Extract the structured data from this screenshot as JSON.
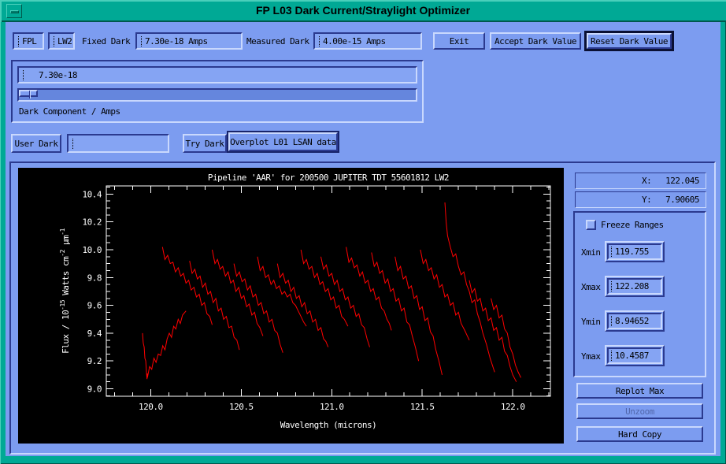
{
  "window": {
    "title": "FP L03 Dark Current/Straylight Optimizer"
  },
  "toolbar": {
    "fpl_value": "FPL",
    "lw2_value": "LW2",
    "fixed_dark_label": "Fixed Dark",
    "fixed_dark_value": "7.30e-18 Amps",
    "measured_dark_label": "Measured Dark",
    "measured_dark_value": "4.00e-15 Amps",
    "exit_label": "Exit",
    "accept_label": "Accept Dark Value",
    "reset_label": "Reset Dark Value"
  },
  "dark_component": {
    "value": "7.30e-18",
    "label": "Dark Component / Amps",
    "slider_fraction": 0.0
  },
  "user_dark": {
    "button_label": "User Dark",
    "input_value": "",
    "try_label": "Try Dark",
    "overplot_label": "Overplot L01 LSAN data"
  },
  "readout": {
    "x_label": "X:",
    "x_value": "122.045",
    "y_label": "Y:",
    "y_value": "7.90605"
  },
  "ranges": {
    "freeze_label": "Freeze Ranges",
    "xmin_label": "Xmin",
    "xmin_value": "119.755",
    "xmax_label": "Xmax",
    "xmax_value": "122.208",
    "ymin_label": "Ymin",
    "ymin_value": "8.94652",
    "ymax_label": "Ymax",
    "ymax_value": "10.4587"
  },
  "actions": {
    "replot_label": "Replot Max",
    "unzoom_label": "Unzoom",
    "hardcopy_label": "Hard Copy"
  },
  "colors": {
    "titlebar": "#00a995",
    "background": "#7c9cf0",
    "plot_bg": "#000000",
    "plot_fg": "#ffffff",
    "series": "#ff0000"
  },
  "chart_data": {
    "type": "line",
    "title": "Pipeline 'AAR' for 200500 JUPITER TDT 55601812 LW2",
    "xlabel": "Wavelength (microns)",
    "ylabel_parts": [
      {
        "t": "Flux  /  10"
      },
      {
        "s": "-15"
      },
      {
        "t": " Watts cm"
      },
      {
        "s": "-2"
      },
      {
        "t": " μm"
      },
      {
        "s": "-1"
      }
    ],
    "xlim": [
      119.755,
      122.208
    ],
    "ylim": [
      8.94652,
      10.4587
    ],
    "x_major_ticks": [
      120.0,
      120.5,
      121.0,
      121.5,
      122.0
    ],
    "x_major_labels": [
      "120.0",
      "120.5",
      "121.0",
      "121.5",
      "122.0"
    ],
    "x_minor_step": 0.1,
    "y_major_ticks": [
      9.0,
      9.2,
      9.4,
      9.6,
      9.8,
      10.0,
      10.2,
      10.4
    ],
    "y_minor_step": 0.05,
    "grid": false,
    "legend": "none",
    "series_color": "#ff0000",
    "scans": [
      [
        [
          119.955,
          9.4
        ],
        [
          119.959,
          9.33
        ],
        [
          119.964,
          9.3
        ],
        [
          119.968,
          9.22
        ],
        [
          119.973,
          9.2
        ],
        [
          119.977,
          9.12
        ],
        [
          119.98,
          9.07
        ],
        [
          119.982,
          9.11
        ]
      ],
      [
        [
          119.982,
          9.08
        ],
        [
          119.994,
          9.16
        ],
        [
          120.006,
          9.14
        ],
        [
          120.018,
          9.22
        ],
        [
          120.03,
          9.19
        ],
        [
          120.042,
          9.25
        ],
        [
          120.055,
          9.24
        ],
        [
          120.067,
          9.31
        ],
        [
          120.079,
          9.28
        ],
        [
          120.091,
          9.36
        ],
        [
          120.103,
          9.4
        ],
        [
          120.115,
          9.37
        ],
        [
          120.127,
          9.45
        ],
        [
          120.139,
          9.43
        ],
        [
          120.152,
          9.5
        ],
        [
          120.164,
          9.47
        ],
        [
          120.176,
          9.53
        ],
        [
          120.195,
          9.56
        ]
      ],
      [
        [
          120.065,
          10.02
        ],
        [
          120.079,
          9.93
        ],
        [
          120.094,
          9.96
        ],
        [
          120.108,
          9.9
        ],
        [
          120.123,
          9.91
        ],
        [
          120.137,
          9.84
        ],
        [
          120.152,
          9.87
        ],
        [
          120.166,
          9.81
        ],
        [
          120.181,
          9.83
        ],
        [
          120.195,
          9.76
        ],
        [
          120.21,
          9.78
        ],
        [
          120.224,
          9.71
        ],
        [
          120.239,
          9.73
        ],
        [
          120.253,
          9.66
        ],
        [
          120.268,
          9.68
        ],
        [
          120.282,
          9.6
        ],
        [
          120.297,
          9.62
        ],
        [
          120.311,
          9.54
        ],
        [
          120.326,
          9.52
        ],
        [
          120.34,
          9.46
        ]
      ],
      [
        [
          120.215,
          9.92
        ],
        [
          120.229,
          9.83
        ],
        [
          120.244,
          9.86
        ],
        [
          120.258,
          9.79
        ],
        [
          120.273,
          9.81
        ],
        [
          120.287,
          9.73
        ],
        [
          120.302,
          9.76
        ],
        [
          120.316,
          9.68
        ],
        [
          120.331,
          9.7
        ],
        [
          120.345,
          9.62
        ],
        [
          120.36,
          9.65
        ],
        [
          120.374,
          9.56
        ],
        [
          120.389,
          9.58
        ],
        [
          120.403,
          9.5
        ],
        [
          120.418,
          9.52
        ],
        [
          120.432,
          9.44
        ],
        [
          120.447,
          9.45
        ],
        [
          120.461,
          9.37
        ],
        [
          120.476,
          9.35
        ],
        [
          120.49,
          9.28
        ]
      ],
      [
        [
          120.34,
          10.0
        ],
        [
          120.355,
          9.9
        ],
        [
          120.369,
          9.93
        ],
        [
          120.384,
          9.86
        ],
        [
          120.398,
          9.88
        ],
        [
          120.413,
          9.81
        ],
        [
          120.428,
          9.84
        ],
        [
          120.442,
          9.76
        ],
        [
          120.457,
          9.78
        ],
        [
          120.471,
          9.7
        ],
        [
          120.486,
          9.73
        ],
        [
          120.501,
          9.65
        ],
        [
          120.515,
          9.67
        ],
        [
          120.53,
          9.59
        ],
        [
          120.544,
          9.61
        ],
        [
          120.559,
          9.53
        ],
        [
          120.574,
          9.55
        ],
        [
          120.588,
          9.47
        ],
        [
          120.603,
          9.44
        ],
        [
          120.62,
          9.38
        ]
      ],
      [
        [
          120.46,
          9.9
        ],
        [
          120.475,
          9.81
        ],
        [
          120.49,
          9.84
        ],
        [
          120.505,
          9.77
        ],
        [
          120.52,
          9.79
        ],
        [
          120.535,
          9.71
        ],
        [
          120.55,
          9.74
        ],
        [
          120.565,
          9.66
        ],
        [
          120.58,
          9.68
        ],
        [
          120.595,
          9.6
        ],
        [
          120.61,
          9.62
        ],
        [
          120.625,
          9.54
        ],
        [
          120.64,
          9.56
        ],
        [
          120.655,
          9.48
        ],
        [
          120.67,
          9.5
        ],
        [
          120.685,
          9.42
        ],
        [
          120.7,
          9.4
        ],
        [
          120.715,
          9.32
        ],
        [
          120.73,
          9.26
        ]
      ],
      [
        [
          120.59,
          9.95
        ],
        [
          120.605,
          9.85
        ],
        [
          120.62,
          9.88
        ],
        [
          120.635,
          9.8
        ],
        [
          120.65,
          9.82
        ],
        [
          120.665,
          9.75
        ],
        [
          120.68,
          9.78
        ],
        [
          120.695,
          9.72
        ],
        [
          120.71,
          9.74
        ],
        [
          120.725,
          9.68
        ],
        [
          120.74,
          9.7
        ],
        [
          120.755,
          9.66
        ],
        [
          120.77,
          9.68
        ],
        [
          120.785,
          9.62
        ],
        [
          120.8,
          9.6
        ],
        [
          120.815,
          9.56
        ],
        [
          120.83,
          9.52
        ],
        [
          120.845,
          9.48
        ],
        [
          120.86,
          9.45
        ]
      ],
      [
        [
          120.7,
          9.9
        ],
        [
          120.715,
          9.8
        ],
        [
          120.73,
          9.83
        ],
        [
          120.745,
          9.76
        ],
        [
          120.76,
          9.78
        ],
        [
          120.775,
          9.7
        ],
        [
          120.79,
          9.73
        ],
        [
          120.805,
          9.65
        ],
        [
          120.82,
          9.67
        ],
        [
          120.835,
          9.59
        ],
        [
          120.85,
          9.62
        ],
        [
          120.865,
          9.54
        ],
        [
          120.88,
          9.56
        ],
        [
          120.895,
          9.48
        ],
        [
          120.91,
          9.5
        ],
        [
          120.925,
          9.42
        ],
        [
          120.94,
          9.44
        ],
        [
          120.955,
          9.36
        ],
        [
          120.968,
          9.34
        ],
        [
          120.98,
          9.3
        ]
      ],
      [
        [
          120.83,
          10.0
        ],
        [
          120.845,
          9.9
        ],
        [
          120.86,
          9.93
        ],
        [
          120.875,
          9.86
        ],
        [
          120.89,
          9.88
        ],
        [
          120.905,
          9.8
        ],
        [
          120.92,
          9.83
        ],
        [
          120.935,
          9.75
        ],
        [
          120.95,
          9.77
        ],
        [
          120.965,
          9.7
        ],
        [
          120.98,
          9.72
        ],
        [
          120.995,
          9.64
        ],
        [
          121.01,
          9.66
        ],
        [
          121.025,
          9.58
        ],
        [
          121.04,
          9.6
        ],
        [
          121.055,
          9.52
        ],
        [
          121.07,
          9.5
        ],
        [
          121.09,
          9.45
        ]
      ],
      [
        [
          120.94,
          9.95
        ],
        [
          120.955,
          9.86
        ],
        [
          120.97,
          9.89
        ],
        [
          120.985,
          9.81
        ],
        [
          121.0,
          9.83
        ],
        [
          121.015,
          9.75
        ],
        [
          121.03,
          9.78
        ],
        [
          121.045,
          9.7
        ],
        [
          121.06,
          9.72
        ],
        [
          121.075,
          9.64
        ],
        [
          121.09,
          9.66
        ],
        [
          121.105,
          9.58
        ],
        [
          121.12,
          9.6
        ],
        [
          121.135,
          9.52
        ],
        [
          121.15,
          9.54
        ],
        [
          121.165,
          9.46
        ],
        [
          121.18,
          9.44
        ],
        [
          121.195,
          9.36
        ],
        [
          121.21,
          9.3
        ]
      ],
      [
        [
          121.08,
          10.02
        ],
        [
          121.095,
          9.91
        ],
        [
          121.11,
          9.94
        ],
        [
          121.125,
          9.87
        ],
        [
          121.14,
          9.89
        ],
        [
          121.155,
          9.81
        ],
        [
          121.17,
          9.84
        ],
        [
          121.185,
          9.76
        ],
        [
          121.2,
          9.78
        ],
        [
          121.215,
          9.7
        ],
        [
          121.23,
          9.72
        ],
        [
          121.245,
          9.64
        ],
        [
          121.26,
          9.66
        ],
        [
          121.275,
          9.58
        ],
        [
          121.29,
          9.56
        ],
        [
          121.305,
          9.5
        ],
        [
          121.318,
          9.47
        ],
        [
          121.33,
          9.42
        ]
      ],
      [
        [
          121.22,
          9.98
        ],
        [
          121.235,
          9.88
        ],
        [
          121.25,
          9.91
        ],
        [
          121.265,
          9.83
        ],
        [
          121.28,
          9.85
        ],
        [
          121.295,
          9.76
        ],
        [
          121.31,
          9.79
        ],
        [
          121.325,
          9.7
        ],
        [
          121.34,
          9.72
        ],
        [
          121.355,
          9.63
        ],
        [
          121.37,
          9.65
        ],
        [
          121.385,
          9.56
        ],
        [
          121.4,
          9.58
        ],
        [
          121.415,
          9.48
        ],
        [
          121.43,
          9.46
        ],
        [
          121.445,
          9.38
        ],
        [
          121.462,
          9.3
        ],
        [
          121.48,
          9.2
        ]
      ],
      [
        [
          121.35,
          9.95
        ],
        [
          121.365,
          9.85
        ],
        [
          121.38,
          9.88
        ],
        [
          121.395,
          9.79
        ],
        [
          121.41,
          9.81
        ],
        [
          121.425,
          9.72
        ],
        [
          121.44,
          9.74
        ],
        [
          121.455,
          9.65
        ],
        [
          121.47,
          9.67
        ],
        [
          121.485,
          9.57
        ],
        [
          121.5,
          9.59
        ],
        [
          121.515,
          9.49
        ],
        [
          121.53,
          9.51
        ],
        [
          121.545,
          9.41
        ],
        [
          121.56,
          9.38
        ],
        [
          121.575,
          9.28
        ],
        [
          121.592,
          9.2
        ],
        [
          121.61,
          9.1
        ]
      ],
      [
        [
          121.49,
          10.0
        ],
        [
          121.505,
          9.9
        ],
        [
          121.52,
          9.93
        ],
        [
          121.535,
          9.85
        ],
        [
          121.55,
          9.87
        ],
        [
          121.565,
          9.79
        ],
        [
          121.58,
          9.82
        ],
        [
          121.595,
          9.73
        ],
        [
          121.61,
          9.75
        ],
        [
          121.625,
          9.66
        ],
        [
          121.64,
          9.68
        ],
        [
          121.655,
          9.6
        ],
        [
          121.67,
          9.62
        ],
        [
          121.685,
          9.53
        ],
        [
          121.7,
          9.55
        ],
        [
          121.715,
          9.47
        ],
        [
          121.735,
          9.42
        ],
        [
          121.76,
          9.35
        ]
      ],
      [
        [
          121.625,
          10.34
        ],
        [
          121.632,
          10.2
        ],
        [
          121.64,
          10.1
        ],
        [
          121.655,
          10.02
        ],
        [
          121.67,
          9.95
        ],
        [
          121.685,
          9.97
        ],
        [
          121.7,
          9.88
        ],
        [
          121.715,
          9.82
        ],
        [
          121.73,
          9.84
        ],
        [
          121.745,
          9.75
        ],
        [
          121.76,
          9.7
        ],
        [
          121.775,
          9.62
        ],
        [
          121.79,
          9.64
        ],
        [
          121.805,
          9.54
        ],
        [
          121.82,
          9.48
        ],
        [
          121.835,
          9.4
        ],
        [
          121.855,
          9.32
        ],
        [
          121.875,
          9.22
        ],
        [
          121.9,
          9.12
        ]
      ],
      [
        [
          121.76,
          9.78
        ],
        [
          121.775,
          9.69
        ],
        [
          121.79,
          9.72
        ],
        [
          121.805,
          9.63
        ],
        [
          121.82,
          9.65
        ],
        [
          121.835,
          9.56
        ],
        [
          121.85,
          9.58
        ],
        [
          121.865,
          9.49
        ],
        [
          121.88,
          9.51
        ],
        [
          121.895,
          9.42
        ],
        [
          121.91,
          9.44
        ],
        [
          121.925,
          9.35
        ],
        [
          121.94,
          9.37
        ],
        [
          121.955,
          9.27
        ],
        [
          121.97,
          9.24
        ],
        [
          121.985,
          9.16
        ],
        [
          122.0,
          9.1
        ],
        [
          122.02,
          9.05
        ]
      ],
      [
        [
          121.88,
          9.65
        ],
        [
          121.895,
          9.57
        ],
        [
          121.91,
          9.6
        ],
        [
          121.925,
          9.51
        ],
        [
          121.94,
          9.53
        ],
        [
          121.955,
          9.43
        ],
        [
          121.97,
          9.4
        ],
        [
          121.985,
          9.3
        ],
        [
          122.0,
          9.25
        ],
        [
          122.015,
          9.17
        ],
        [
          122.03,
          9.12
        ],
        [
          122.045,
          9.08
        ]
      ]
    ]
  }
}
